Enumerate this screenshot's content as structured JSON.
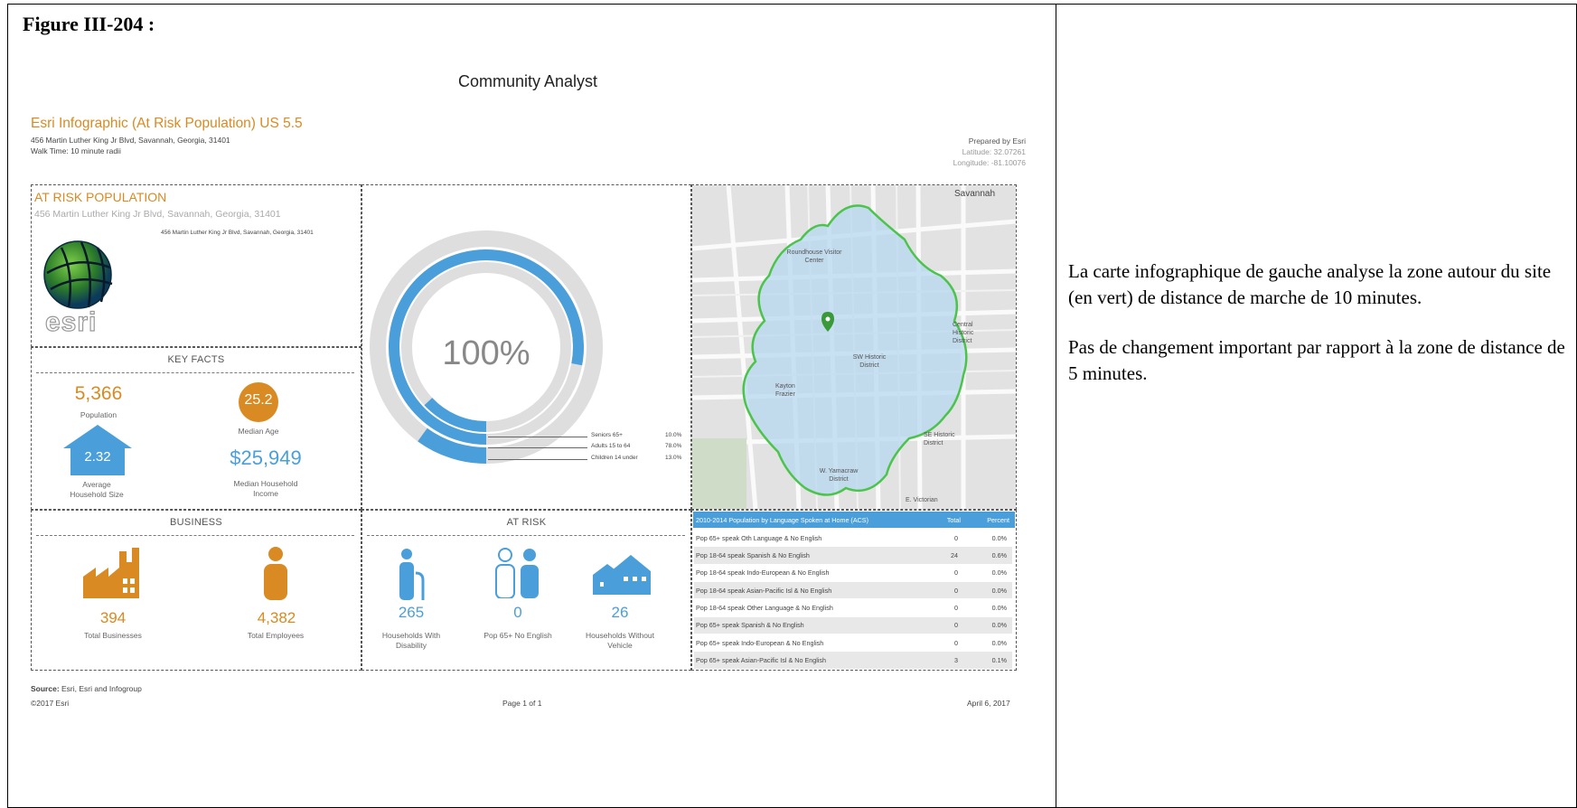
{
  "figure_title": "Figure III-204 :",
  "description": {
    "p1": "La carte infographique de gauche analyse la zone autour du site (en vert) de distance de marche de 10 minutes.",
    "p2": "Pas de changement important par rapport à la zone de distance de 5 minutes."
  },
  "report": {
    "header": "Community Analyst",
    "title": "Esri Infographic (At Risk Population) US 5.5",
    "address": "456 Martin Luther King Jr Blvd, Savannah, Georgia, 31401",
    "walk_time": "Walk Time: 10 minute radii",
    "prepared_by": "Prepared by Esri",
    "latitude": "Latitude: 32.07261",
    "longitude": "Longitude: -81.10076"
  },
  "at_risk_panel": {
    "title": "AT RISK POPULATION",
    "address": "456 Martin Luther King Jr Blvd, Savannah, Georgia, 31401",
    "address_small": "456 Martin Luther King Jr Blvd, Savannah, Georgia, 31401",
    "logo_text": "esri"
  },
  "key_facts": {
    "heading": "KEY FACTS",
    "population_value": "5,366",
    "population_label": "Population",
    "median_age_value": "25.2",
    "median_age_label": "Median Age",
    "household_size_value": "2.32",
    "household_size_label_1": "Average",
    "household_size_label_2": "Household Size",
    "income_value": "$25,949",
    "income_label_1": "Median Household",
    "income_label_2": "Income"
  },
  "donut": {
    "center": "100%",
    "legend": [
      {
        "label": "Seniors 65+",
        "value": "10.0%"
      },
      {
        "label": "Adults 15 to 64",
        "value": "78.0%"
      },
      {
        "label": "Children 14 under",
        "value": "13.0%"
      }
    ],
    "color": "#4a9fdb"
  },
  "map": {
    "city": "Savannah",
    "labels": {
      "roundhouse": "Roundhouse Visitor Center",
      "sw": "SW Historic District",
      "central": "Central Historic District",
      "kayton": "Kayton Frazier",
      "se": "SE Historic District",
      "wy": "W. Yamacraw District",
      "ev": "E. Victorian"
    }
  },
  "language_table": {
    "header": [
      "2010-2014 Population by Language Spoken at Home (ACS)",
      "Total",
      "Percent"
    ],
    "rows": [
      [
        "Pop 65+ speak Oth Language & No English",
        "0",
        "0.0%"
      ],
      [
        "Pop 18-64 speak Spanish & No English",
        "24",
        "0.6%"
      ],
      [
        "Pop 18-64 speak Indo-European & No English",
        "0",
        "0.0%"
      ],
      [
        "Pop 18-64 speak Asian-Pacific Isl & No English",
        "0",
        "0.0%"
      ],
      [
        "Pop 18-64 speak Other Language & No English",
        "0",
        "0.0%"
      ],
      [
        "Pop 65+ speak Spanish & No English",
        "0",
        "0.0%"
      ],
      [
        "Pop 65+ speak Indo-European & No English",
        "0",
        "0.0%"
      ],
      [
        "Pop 65+ speak Asian-Pacific Isl & No English",
        "3",
        "0.1%"
      ]
    ]
  },
  "business": {
    "heading": "BUSINESS",
    "businesses_value": "394",
    "businesses_label": "Total Businesses",
    "employees_value": "4,382",
    "employees_label": "Total Employees"
  },
  "at_risk": {
    "heading": "AT RISK",
    "disability_value": "265",
    "disability_label_1": "Households With",
    "disability_label_2": "Disability",
    "no_english_value": "0",
    "no_english_label": "Pop 65+ No English",
    "no_vehicle_value": "26",
    "no_vehicle_label_1": "Households Without",
    "no_vehicle_label_2": "Vehicle"
  },
  "footer": {
    "source_bold": "Source:",
    "source": " Esri, Esri and Infogroup",
    "copyright": "©2017 Esri",
    "page": "Page 1 of 1",
    "date": "April 6, 2017"
  },
  "colors": {
    "orange": "#d98a22",
    "blue": "#4a9fdb",
    "map_green": "#4cc44c"
  }
}
